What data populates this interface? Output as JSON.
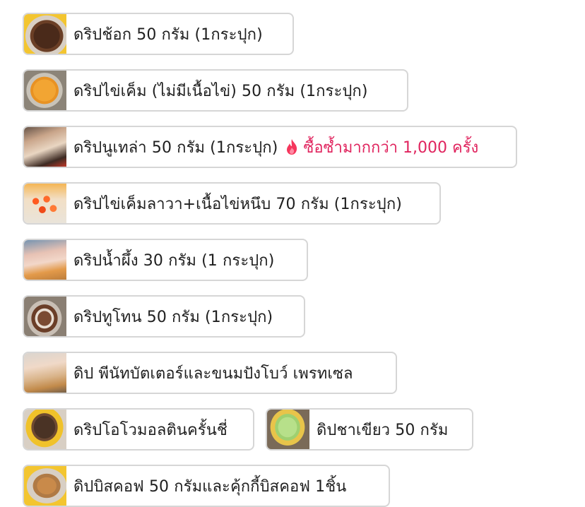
{
  "items": [
    {
      "label": "ดริปช้อก 50 กรัม (1กระปุก)",
      "thumb": "chocolate-dip"
    },
    {
      "label": "ดริปไข่เค็ม (ไม่มีเนื้อไข่) 50 กรัม (1กระปุก)",
      "thumb": "salted-egg-dip"
    },
    {
      "label": "ดริปนูเทล่า 50 กรัม (1กระปุก)",
      "thumb": "nutella-dip",
      "badge": "ซื้อซ้ำมากกว่า 1,000 ครั้ง",
      "badge_icon": "fire-icon",
      "badge_color": "#e0245e"
    },
    {
      "label": "ดริปไข่เค็มลาวา+เนื้อไข่หนึบ 70 กรัม (1กระปุก)",
      "thumb": "lava-dip"
    },
    {
      "label": "ดริปน้ำผึ้ง 30 กรัม (1 กระปุก)",
      "thumb": "honey-dip"
    },
    {
      "label": "ดริปทูโทน 50 กรัม (1กระปุก)",
      "thumb": "two-tone-dip"
    },
    {
      "label": "ดิป พีนัทบัตเตอร์และขนมปังโบว์ เพรทเซล",
      "thumb": "peanut-butter-dip"
    },
    {
      "label": "ดริปโอโวมอลตินครั้นชี่",
      "thumb": "ovaltine-dip"
    },
    {
      "label": "ดิปชาเขียว 50 กรัม",
      "thumb": "green-tea-dip"
    },
    {
      "label": "ดิปบิสคอฟ 50 กรัมและคุ้กกี้บิสคอฟ 1ชิ้น",
      "thumb": "biscoff-dip"
    }
  ]
}
